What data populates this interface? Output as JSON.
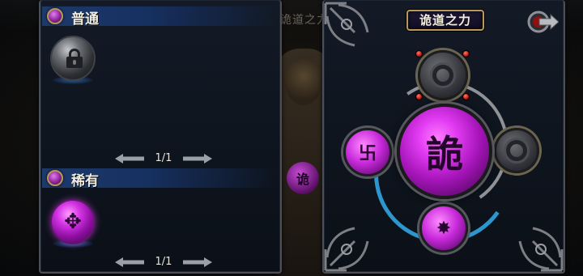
{
  "background": {
    "title": "诡道之力",
    "orb_glyph": "诡"
  },
  "left_panel": {
    "sections": [
      {
        "id": "common",
        "title": "普通",
        "pager": {
          "text": "1/1"
        },
        "slot_state": "locked"
      },
      {
        "id": "rare",
        "title": "稀有",
        "pager": {
          "text": "1/1"
        },
        "slot_state": "unlocked"
      }
    ]
  },
  "right_panel": {
    "title": "诡道之力",
    "center_node": {
      "glyph": "詭",
      "state": "active"
    },
    "nodes": [
      {
        "position": "top",
        "state": "inactive"
      },
      {
        "position": "right",
        "state": "inactive"
      },
      {
        "position": "left",
        "state": "active"
      },
      {
        "position": "bottom",
        "state": "active"
      }
    ]
  },
  "colors": {
    "accent_purple": "#d433e6",
    "header_blue": "#1d3a6b",
    "ring_blue": "#2f9ed6",
    "gold_border": "#b79a58"
  },
  "icons": {
    "exit": "exit-arrow-icon",
    "lock": "lock-icon",
    "pager_prev": "arrow-left-icon",
    "pager_next": "arrow-right-icon"
  }
}
